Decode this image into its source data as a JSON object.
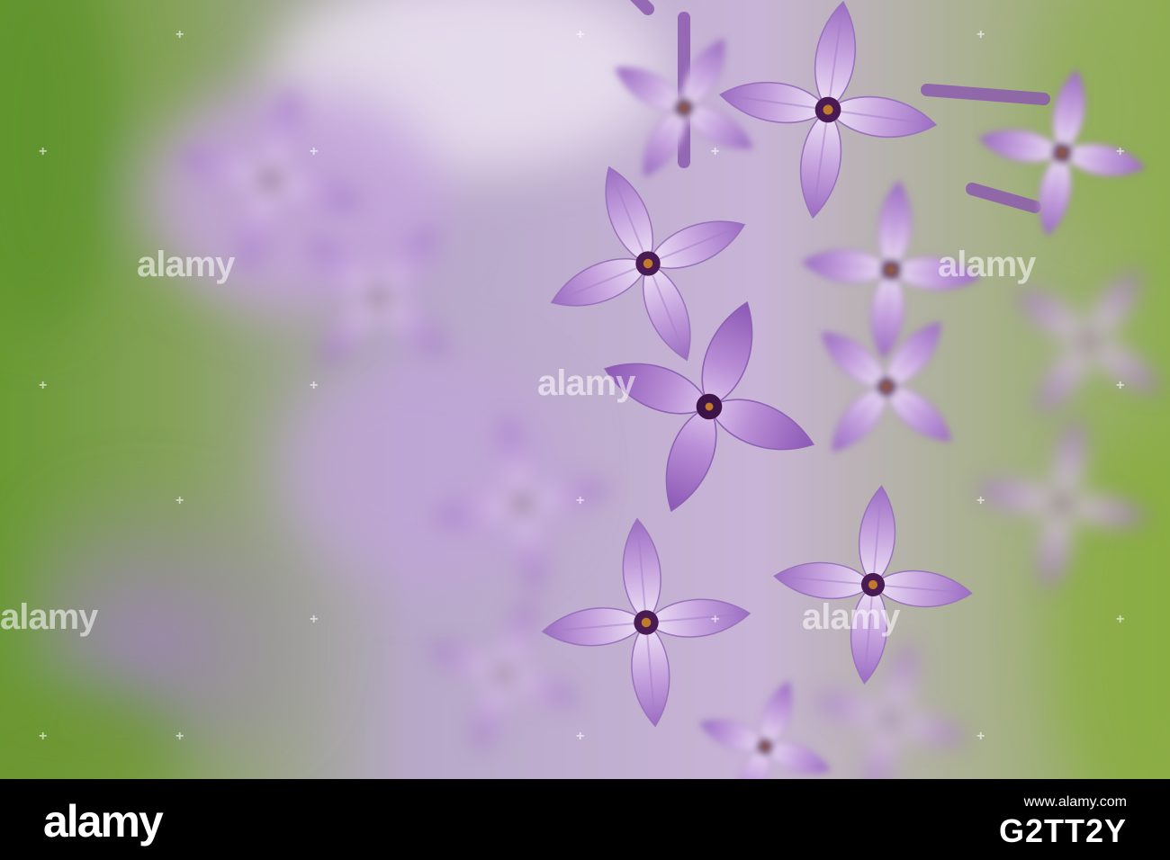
{
  "photo": {
    "subject": "lilac-blossom-cluster",
    "colors": {
      "petal_light": "#e6d4f0",
      "petal_mid": "#c19ad9",
      "petal_dark": "#9b6cc2",
      "center": "#4a1a55",
      "stamen": "#c07a2a",
      "bg_green": "#6f9a3a",
      "bg_purple": "#a98ac0"
    }
  },
  "watermark": {
    "text": "alamy",
    "icon": "plus-mark-icon"
  },
  "footer": {
    "logo": "alamy",
    "site": "www.alamy.com",
    "image_id": "G2TT2Y"
  }
}
